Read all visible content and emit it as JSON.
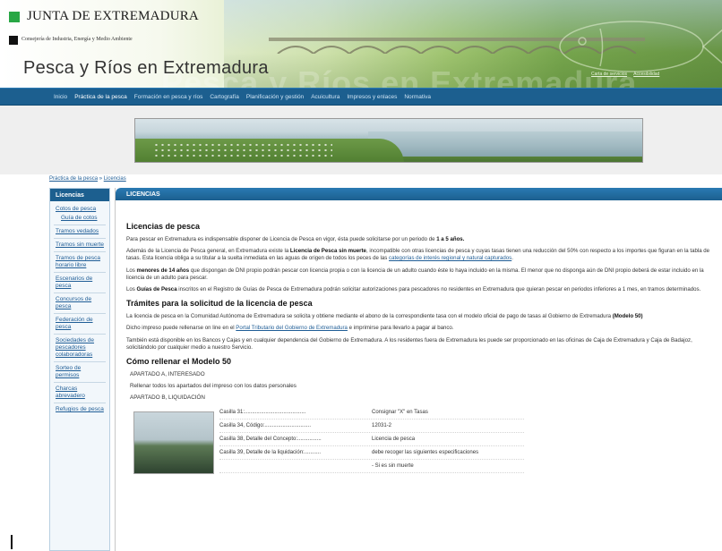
{
  "header": {
    "org_name": "JUNTA DE EXTREMADURA",
    "consejeria": "Consejería de Industria, Energía y Medio Ambiente",
    "site_title": "Pesca y Ríos en Extremadura",
    "site_title_ghost": "Pesca y Ríos en Extremadura",
    "top_links": [
      "Carta de servicios",
      "Accesibilidad"
    ],
    "brand_green": "#28a745",
    "nav_blue": "#1c5f8f"
  },
  "nav": {
    "items": [
      "Inicio",
      "Práctica de la pesca",
      "Formación en pesca y ríos",
      "Cartografía",
      "Planificación y gestión",
      "Acuicultura",
      "Impresos y enlaces",
      "Normativa"
    ],
    "active": "Práctica de la pesca"
  },
  "breadcrumb": {
    "parent": "Práctica de la pesca",
    "separator": "»",
    "current": "Licencias"
  },
  "sidebar": {
    "title": "Licencias",
    "items": [
      {
        "label": "Cotos de pesca",
        "sub": false
      },
      {
        "label": "Guía de cotos",
        "sub": true
      },
      {
        "label": "Tramos vedados",
        "sub": false
      },
      {
        "label": "Tramos sin muerte",
        "sub": false
      },
      {
        "label": "Tramos de pesca horario libre",
        "sub": false
      },
      {
        "label": "Escenarios de pesca",
        "sub": false
      },
      {
        "label": "Concursos de pesca",
        "sub": false
      },
      {
        "label": "Federación de pesca",
        "sub": false
      },
      {
        "label": "Sociedades de pescadores colaboradoras",
        "sub": false
      },
      {
        "label": "Sorteo de permisos",
        "sub": false
      },
      {
        "label": "Charcas abrevadero",
        "sub": false
      },
      {
        "label": "Refugios de pesca",
        "sub": false
      }
    ]
  },
  "content": {
    "section_title": "LICENCIAS",
    "h_licencias": "Licencias de pesca",
    "p1_a": "Para pescar en Extremadura es indispensable disponer de Licencia de Pesca en vigor, ésta puede solicitarse por un periodo de ",
    "p1_b": "1 a 5 años.",
    "p2_a": "Además de la Licencia de Pesca general, en Extremadura existe la ",
    "p2_b": "Licencia de Pesca sin muerte",
    "p2_c": ", incompatible con otras licencias de pesca y cuyas tasas tienen una reducción del 50% con respecto a los importes que figuran en la tabla de tasas. Esta licencia obliga a su titular a la suelta inmediata en las aguas de origen de todos los peces de las ",
    "p2_link": "categorías de interés regional y natural capturados",
    "p2_d": ".",
    "p3_a": "Los ",
    "p3_b": "menores de 14 años",
    "p3_c": " que dispongan de DNI propio podrán pescar con licencia propia o con la licencia de un adulto cuando éste lo haya incluido en la misma. El menor que no disponga aún de DNI propio deberá de estar incluido en la licencia de un adulto para pescar.",
    "p4_a": "Los ",
    "p4_b": "Guías de Pesca",
    "p4_c": " inscritos en el Registro de Guías de Pesca de Extremadura podrán solicitar autorizaciones para pescadores no residentes en Extremadura que quieran pescar en periodos inferiores a 1 mes, en tramos determinados.",
    "h_tramites": "Trámites para la solicitud de la licencia de pesca",
    "p5_a": "La licencia de pesca en la Comunidad Autónoma de Extremadura se solicita y obtiene mediante el abono de la correspondiente tasa con el modelo oficial de pago de tasas al Gobierno de Extremadura ",
    "p5_b": "(Modelo 50)",
    "p6_a": "Dicho impreso puede rellenarse on line en el ",
    "p6_link": "Portal Tributario del Gobierno de Extremadura",
    "p6_b": " e imprimirse para llevarlo a pagar al banco.",
    "p7": "También está disponible en los Bancos y Cajas y en cualquier dependencia del Gobierno de Extremadura. A los residentes fuera de Extremadura les puede ser proporcionado en las oficinas de Caja de Extremadura y Caja de Badajoz, solicitándolo por cualquier medio a nuestro Servicio.",
    "h_modelo": "Cómo rellenar el Modelo 50",
    "apartado_a": "APARTADO A, INTERESADO",
    "apartado_a_text": "Rellenar todos los apartados del impreso con los datos personales",
    "apartado_b": "APARTADO B, LIQUIDACIÓN",
    "casillas": [
      {
        "k": "Casilla 31:.........................................",
        "v": "Consignar \"X\" en Tasas"
      },
      {
        "k": "Casilla 34, Código:...............................",
        "v": "12031-2"
      },
      {
        "k": "Casilla 38, Detalle del Concepto:................",
        "v": "Licencia de pesca"
      },
      {
        "k": "Casilla 39, Detalle de la liquidación:...........",
        "v": "debe recoger las siguientes especificaciones"
      },
      {
        "k": "",
        "v": "- Si es sin muerte"
      }
    ]
  }
}
